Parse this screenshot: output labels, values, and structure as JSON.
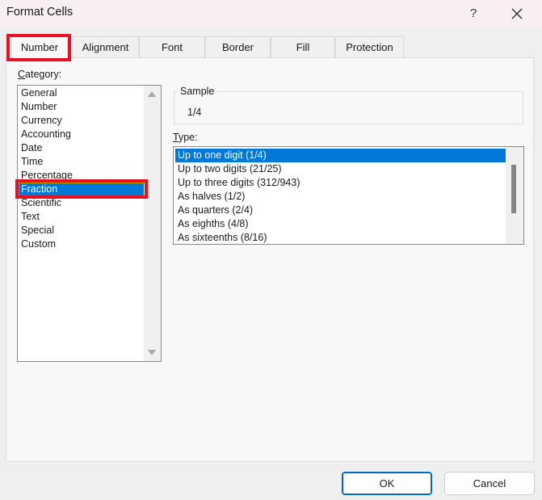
{
  "window": {
    "title": "Format Cells",
    "help_label": "?",
    "close_icon": "close-icon"
  },
  "tabs": [
    {
      "label": "Number",
      "active": true
    },
    {
      "label": "Alignment",
      "active": false
    },
    {
      "label": "Font",
      "active": false
    },
    {
      "label": "Border",
      "active": false
    },
    {
      "label": "Fill",
      "active": false
    },
    {
      "label": "Protection",
      "active": false
    }
  ],
  "category": {
    "label_first": "C",
    "label_rest": "ategory:",
    "items": [
      "General",
      "Number",
      "Currency",
      "Accounting",
      "Date",
      "Time",
      "Percentage",
      "Fraction",
      "Scientific",
      "Text",
      "Special",
      "Custom"
    ],
    "selected": "Fraction"
  },
  "sample": {
    "legend": "Sample",
    "value": "1/4"
  },
  "type": {
    "label_first": "T",
    "label_rest": "ype:",
    "items": [
      "Up to one digit (1/4)",
      "Up to two digits (21/25)",
      "Up to three digits (312/943)",
      "As halves (1/2)",
      "As quarters (2/4)",
      "As eighths (4/8)",
      "As sixteenths (8/16)"
    ],
    "selected": "Up to one digit (1/4)"
  },
  "buttons": {
    "ok": "OK",
    "cancel": "Cancel"
  },
  "colors": {
    "selection": "#0078d7",
    "highlight_annotation": "#e81123"
  }
}
